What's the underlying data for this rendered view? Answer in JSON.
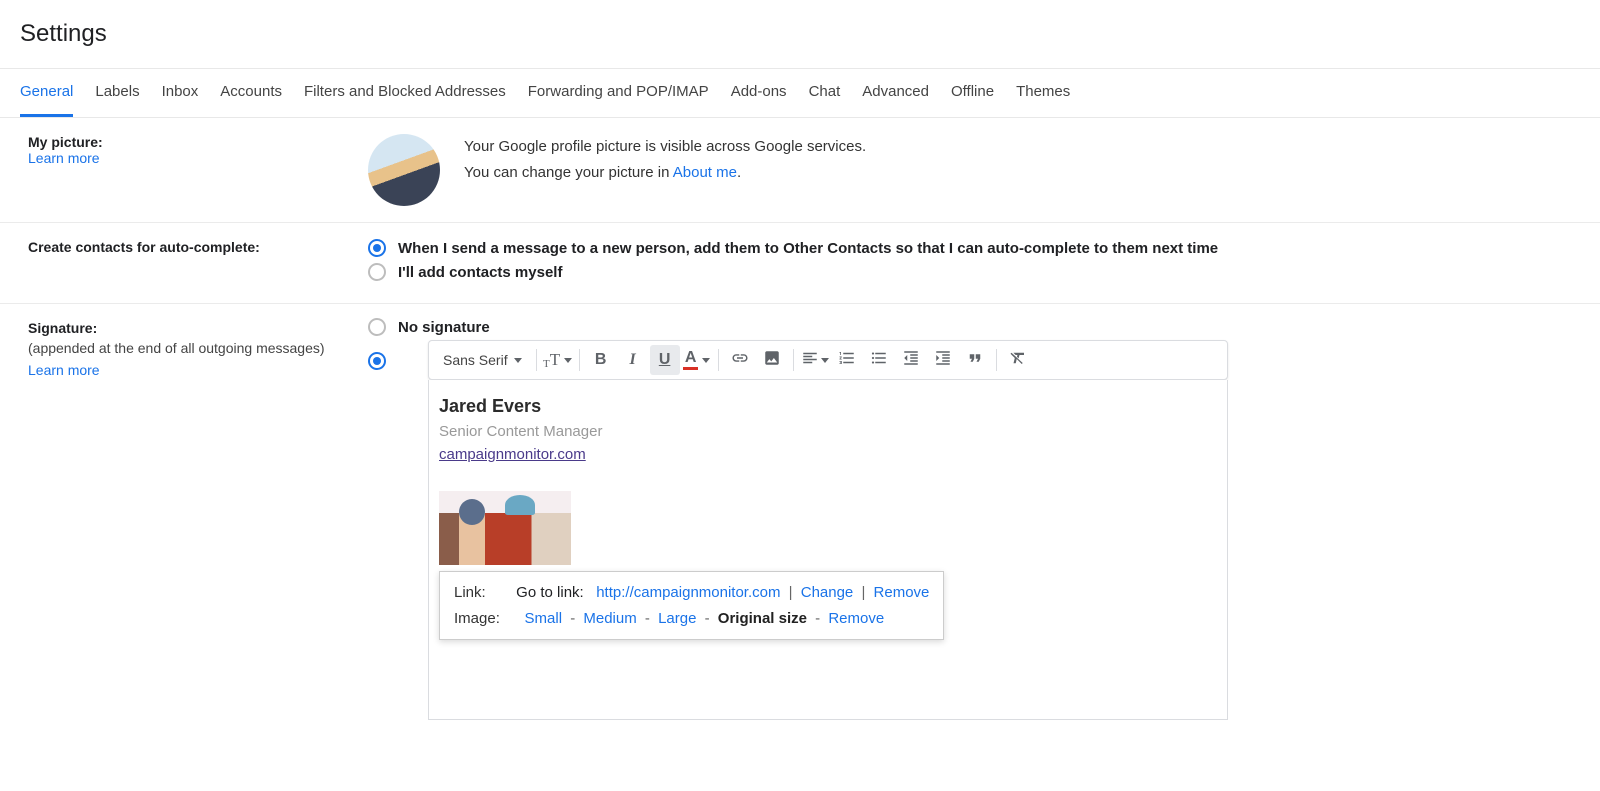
{
  "page_title": "Settings",
  "tabs": [
    "General",
    "Labels",
    "Inbox",
    "Accounts",
    "Filters and Blocked Addresses",
    "Forwarding and POP/IMAP",
    "Add-ons",
    "Chat",
    "Advanced",
    "Offline",
    "Themes"
  ],
  "active_tab": 0,
  "sections": {
    "picture": {
      "label": "My picture:",
      "learn_more": "Learn more",
      "text1": "Your Google profile picture is visible across Google services.",
      "text2_pre": "You can change your picture in ",
      "about_me": "About me",
      "text2_post": "."
    },
    "contacts": {
      "label": "Create contacts for auto-complete:",
      "opt1": "When I send a message to a new person, add them to Other Contacts so that I can auto-complete to them next time",
      "opt2": "I'll add contacts myself"
    },
    "signature": {
      "label": "Signature:",
      "sub": "(appended at the end of all outgoing messages)",
      "learn_more": "Learn more",
      "opt_none": "No signature",
      "font_name": "Sans Serif",
      "sig_name": "Jared Evers",
      "sig_title": "Senior Content Manager",
      "sig_url": "campaignmonitor.com",
      "popup": {
        "link_label": "Link:",
        "goto": "Go to link:",
        "url": "http://campaignmonitor.com",
        "change": "Change",
        "remove": "Remove",
        "image_label": "Image:",
        "small": "Small",
        "medium": "Medium",
        "large": "Large",
        "original": "Original size",
        "remove2": "Remove"
      }
    }
  }
}
